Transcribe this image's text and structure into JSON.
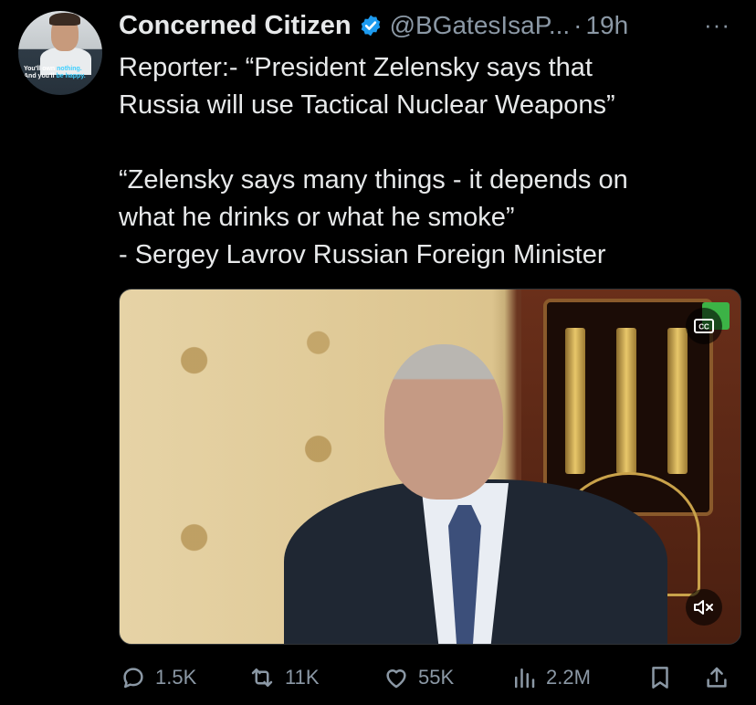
{
  "tweet": {
    "display_name": "Concerned Citizen",
    "handle": "@BGatesIsaP...",
    "dot": "·",
    "time": "19h",
    "more_label": "···",
    "text_lines": [
      "Reporter:- “President Zelensky says that",
      "Russia will use Tactical Nuclear Weapons”",
      "“Zelensky says many things - it depends on",
      "what he drinks or what he smoke”",
      "- Sergey Lavrov Russian Foreign Minister"
    ]
  },
  "avatar": {
    "caption_line1": "You'll own ",
    "caption_hl1": "nothing.",
    "caption_line2": "And you'll ",
    "caption_hl2": "be happy."
  },
  "media": {
    "cc_label": "CC",
    "icons": [
      "cc-icon",
      "mute-icon"
    ]
  },
  "actions": {
    "replies": "1.5K",
    "reposts": "11K",
    "likes": "55K",
    "views": "2.2M"
  },
  "colors": {
    "background": "#000000",
    "text": "#e7e9ea",
    "muted": "#8b98a5",
    "verified": "#1d9bf0"
  }
}
